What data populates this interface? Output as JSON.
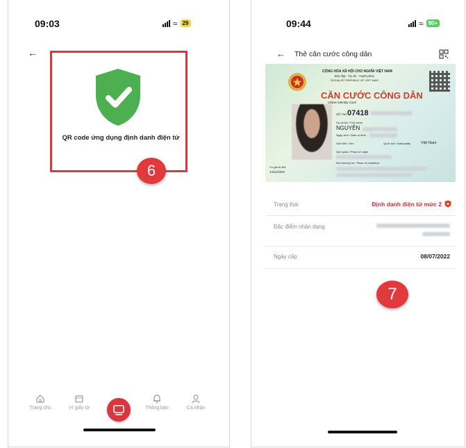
{
  "left": {
    "status_bar": {
      "time": "09:03",
      "battery": "29"
    },
    "qr_title": "QR code ứng dụng định danh điện tử",
    "step_badge": "6",
    "bottom_nav": [
      {
        "label": "Trang chủ",
        "icon": "home-icon"
      },
      {
        "label": "Ví giấy tờ",
        "icon": "wallet-icon"
      },
      {
        "label": "Thông báo",
        "icon": "bell-icon"
      },
      {
        "label": "Cá nhân",
        "icon": "user-icon"
      }
    ]
  },
  "right": {
    "status_bar": {
      "time": "09:44",
      "battery": "80+"
    },
    "header_title": "Thẻ căn cước công dân",
    "card": {
      "country": "CỘNG HÒA XÃ HỘI CHỦ NGHĨA VIỆT NAM",
      "motto": "Độc lập - Tự do - Hạnh phúc",
      "country_en": "SOCIALIST REPUBLIC OF VIET NAM",
      "title": "CĂN CƯỚC CÔNG DÂN",
      "subtitle": "Citizen Identity Card",
      "id_label": "Số / No.",
      "id_number": "07418",
      "name_label": "Họ và tên / Full name",
      "name": "NGUYỄN",
      "dob_label": "Ngày sinh / Date of birth",
      "sex_label": "Giới tính / Sex",
      "nationality_label": "Quốc tịch / Nationality",
      "nationality": "Việt Nam",
      "origin_label": "Quê quán / Place of origin",
      "residence_label": "Nơi thường trú / Place of residence",
      "expiry_label": "Có giá trị đến",
      "expiry": "14/11/2042"
    },
    "rows": [
      {
        "label": "Trạng thái",
        "value": "Định danh điện tử mức 2"
      },
      {
        "label": "Đặc điểm nhận dạng",
        "value": ""
      },
      {
        "label": "Ngày cấp",
        "value": "08/07/2022"
      }
    ],
    "step_badge": "7"
  },
  "colors": {
    "accent": "#d9363e",
    "shield": "#4caf50",
    "battery_left": "#f1d64a",
    "battery_right": "#5cc95c"
  }
}
